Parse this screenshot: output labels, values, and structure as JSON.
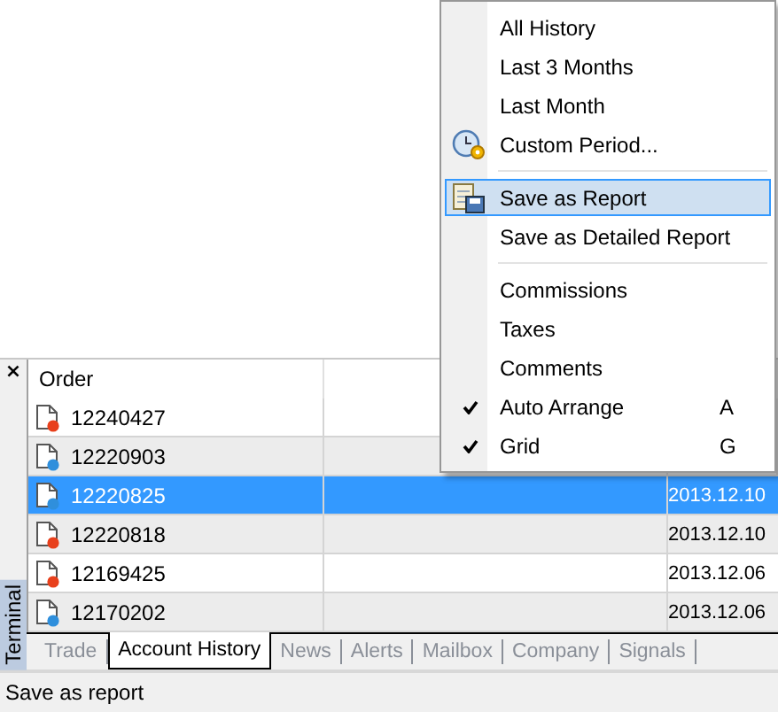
{
  "menu": {
    "groups": [
      [
        {
          "label": "All History",
          "checked": false,
          "selected": false
        },
        {
          "label": "Last 3 Months",
          "checked": false,
          "selected": false
        },
        {
          "label": "Last Month",
          "checked": false,
          "selected": false
        },
        {
          "label": "Custom Period...",
          "kind": "clock",
          "checked": false,
          "selected": false
        }
      ],
      [
        {
          "label": "Save as Report",
          "kind": "report",
          "checked": false,
          "selected": true
        },
        {
          "label": "Save as Detailed Report",
          "checked": false,
          "selected": false
        }
      ],
      [
        {
          "label": "Commissions",
          "checked": false,
          "selected": false
        },
        {
          "label": "Taxes",
          "checked": false,
          "selected": false
        },
        {
          "label": "Comments",
          "checked": false,
          "selected": false
        },
        {
          "label": "Auto Arrange",
          "checked": true,
          "selected": false,
          "shortcut": "A"
        },
        {
          "label": "Grid",
          "checked": true,
          "selected": false,
          "shortcut": "G"
        }
      ]
    ]
  },
  "terminal": {
    "close": "×",
    "title": "Terminal",
    "table": {
      "columns": [
        "Order"
      ],
      "rows": [
        {
          "order": "12240427",
          "color": "#e8401c",
          "selected": false
        },
        {
          "order": "12220903",
          "color": "#2f8fdc",
          "selected": false
        },
        {
          "order": "12220825",
          "color": "#2f8fdc",
          "selected": true,
          "time": "2013.12.10"
        },
        {
          "order": "12220818",
          "color": "#e8401c",
          "selected": false,
          "time": "2013.12.10"
        },
        {
          "order": "12169425",
          "color": "#e8401c",
          "selected": false,
          "time": "2013.12.06"
        },
        {
          "order": "12170202",
          "color": "#2f8fdc",
          "selected": false,
          "time": "2013.12.06"
        }
      ]
    },
    "tabs": [
      {
        "label": "Trade",
        "selected": false
      },
      {
        "label": "Account History",
        "selected": true
      },
      {
        "label": "News",
        "selected": false
      },
      {
        "label": "Alerts",
        "selected": false
      },
      {
        "label": "Mailbox",
        "selected": false
      },
      {
        "label": "Company",
        "selected": false
      },
      {
        "label": "Signals",
        "selected": false
      }
    ]
  },
  "status_bar": {
    "text": "Save as report"
  }
}
